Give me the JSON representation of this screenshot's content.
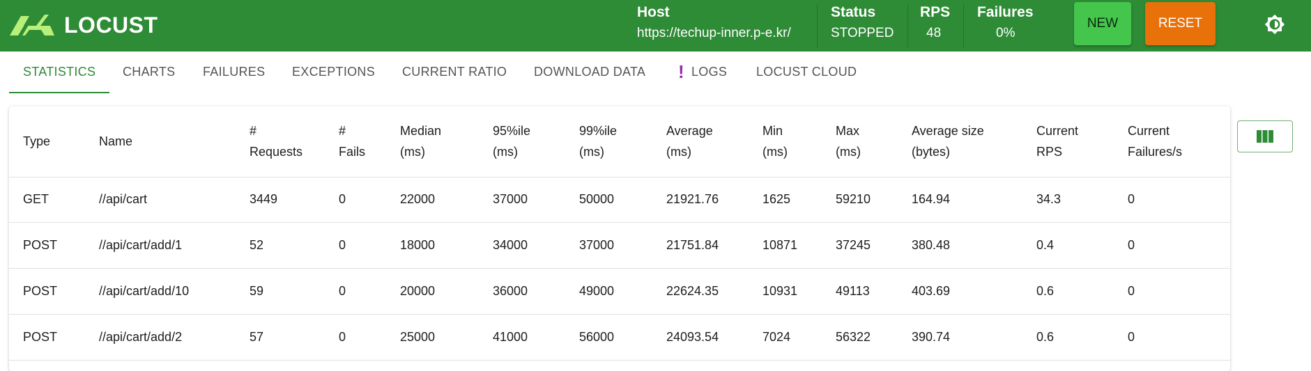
{
  "app": {
    "name": "LOCUST",
    "colors": {
      "brand": "#2e8b36",
      "new_button": "#43c64b",
      "reset_button": "#e8710a",
      "logs_indicator": "#9c27b0"
    }
  },
  "header": {
    "host_label": "Host",
    "host_value": "https://techup-inner.p-e.kr/",
    "status_label": "Status",
    "status_value": "STOPPED",
    "rps_label": "RPS",
    "rps_value": "48",
    "failures_label": "Failures",
    "failures_value": "0%",
    "new_label": "NEW",
    "reset_label": "RESET",
    "theme_icon": "brightness-icon"
  },
  "tabs": [
    {
      "label": "STATISTICS",
      "active": true
    },
    {
      "label": "CHARTS"
    },
    {
      "label": "FAILURES"
    },
    {
      "label": "EXCEPTIONS"
    },
    {
      "label": "CURRENT RATIO"
    },
    {
      "label": "DOWNLOAD DATA"
    },
    {
      "label": "LOGS",
      "indicator": "!"
    },
    {
      "label": "LOCUST CLOUD"
    }
  ],
  "table": {
    "columns": [
      {
        "line1": "Type",
        "line2": ""
      },
      {
        "line1": "Name",
        "line2": ""
      },
      {
        "line1": "#",
        "line2": "Requests"
      },
      {
        "line1": "#",
        "line2": "Fails"
      },
      {
        "line1": "Median",
        "line2": "(ms)"
      },
      {
        "line1": "95%ile",
        "line2": "(ms)"
      },
      {
        "line1": "99%ile",
        "line2": "(ms)"
      },
      {
        "line1": "Average",
        "line2": "(ms)"
      },
      {
        "line1": "Min",
        "line2": "(ms)"
      },
      {
        "line1": "Max",
        "line2": "(ms)"
      },
      {
        "line1": "Average size",
        "line2": "(bytes)"
      },
      {
        "line1": "Current",
        "line2": "RPS"
      },
      {
        "line1": "Current",
        "line2": "Failures/s"
      }
    ],
    "rows": [
      [
        "GET",
        "//api/cart",
        "3449",
        "0",
        "22000",
        "37000",
        "50000",
        "21921.76",
        "1625",
        "59210",
        "164.94",
        "34.3",
        "0"
      ],
      [
        "POST",
        "//api/cart/add/1",
        "52",
        "0",
        "18000",
        "34000",
        "37000",
        "21751.84",
        "10871",
        "37245",
        "380.48",
        "0.4",
        "0"
      ],
      [
        "POST",
        "//api/cart/add/10",
        "59",
        "0",
        "20000",
        "36000",
        "49000",
        "22624.35",
        "10931",
        "49113",
        "403.69",
        "0.6",
        "0"
      ],
      [
        "POST",
        "//api/cart/add/2",
        "57",
        "0",
        "25000",
        "41000",
        "56000",
        "24093.54",
        "7024",
        "56322",
        "390.74",
        "0.6",
        "0"
      ]
    ],
    "column_selector_icon": "view-column-icon"
  }
}
